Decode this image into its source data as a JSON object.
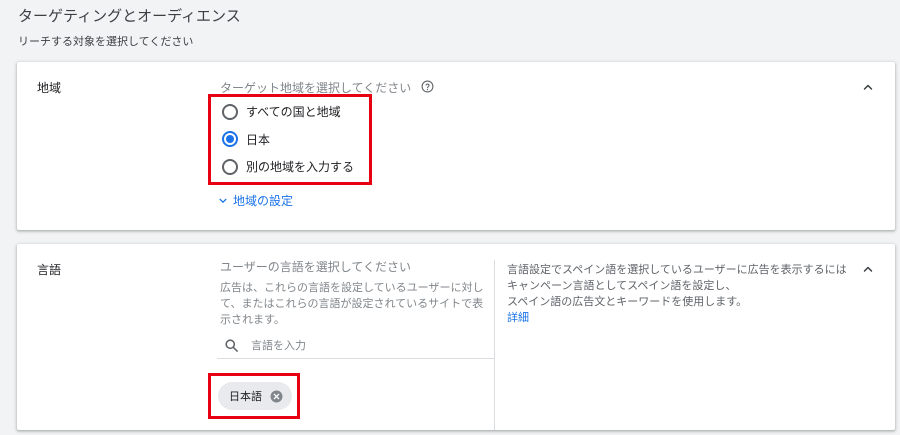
{
  "page": {
    "title": "ターゲティングとオーディエンス",
    "subtitle": "リーチする対象を選択してください"
  },
  "region": {
    "label": "地域",
    "hint": "ターゲット地域を選択してください",
    "options": [
      {
        "label": "すべての国と地域",
        "selected": false
      },
      {
        "label": "日本",
        "selected": true
      },
      {
        "label": "別の地域を入力する",
        "selected": false
      }
    ],
    "settings_link": "地域の設定"
  },
  "language": {
    "label": "言語",
    "hint": "ユーザーの言語を選択してください",
    "description": "広告は、これらの言語を設定しているユーザーに対して、またはこれらの言語が設定されているサイトで表示されます。",
    "search_placeholder": "言語を入力",
    "chips": [
      {
        "label": "日本語"
      }
    ],
    "info": {
      "line1": "言語設定でスペイン語を選択しているユーザーに広告を表示するにはキャンペーン言語としてスペイン語を設定し、",
      "line2": "スペイン語の広告文とキーワードを使用します。",
      "link": "詳細"
    }
  },
  "colors": {
    "accent": "#1a73e8",
    "highlight": "#e60012",
    "background": "#f1f3f4"
  },
  "icons": [
    "help-circle-icon",
    "chevron-up-icon",
    "chevron-down-icon",
    "search-icon",
    "close-circle-icon"
  ]
}
